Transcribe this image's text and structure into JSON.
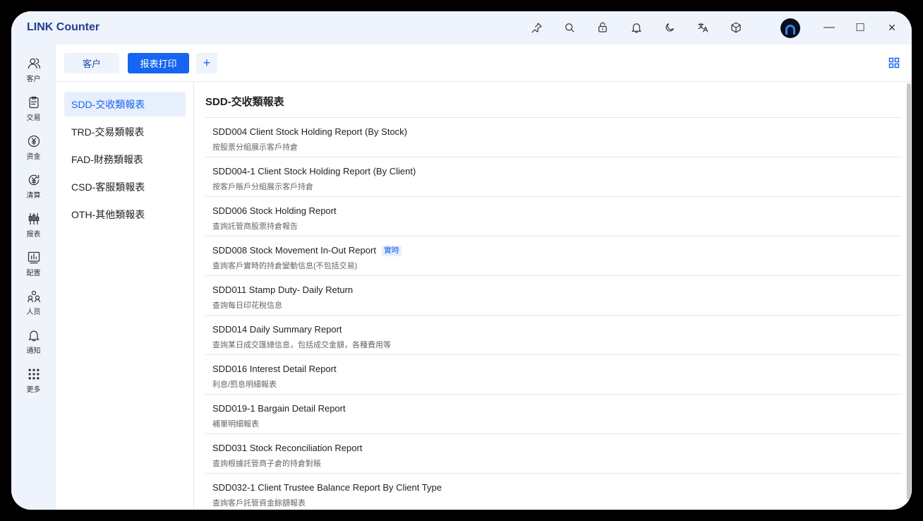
{
  "app": {
    "title": "LINK Counter"
  },
  "titlebar_icons": [
    "pin-icon",
    "search-icon",
    "lock-icon",
    "bell-icon",
    "moon-icon",
    "translate-icon",
    "cube-icon"
  ],
  "window_controls": {
    "minimize": "—",
    "maximize": "☐",
    "close": "✕"
  },
  "sidebar": {
    "items": [
      {
        "label": "客户",
        "icon": "users-icon"
      },
      {
        "label": "交易",
        "icon": "clipboard-icon"
      },
      {
        "label": "资金",
        "icon": "yen-icon"
      },
      {
        "label": "清算",
        "icon": "yen-cycle-icon"
      },
      {
        "label": "报表",
        "icon": "candlestick-icon"
      },
      {
        "label": "配置",
        "icon": "chart-config-icon"
      },
      {
        "label": "人员",
        "icon": "people-group-icon"
      },
      {
        "label": "通知",
        "icon": "bell-icon"
      },
      {
        "label": "更多",
        "icon": "dots-grid-icon"
      }
    ]
  },
  "tabs": {
    "customer": "客户",
    "report_print": "报表打印",
    "add": "+"
  },
  "categories": [
    {
      "label": "SDD-交收類報表",
      "active": true
    },
    {
      "label": "TRD-交易類報表",
      "active": false
    },
    {
      "label": "FAD-財務類報表",
      "active": false
    },
    {
      "label": "CSD-客服類報表",
      "active": false
    },
    {
      "label": "OTH-其他類報表",
      "active": false
    }
  ],
  "section": {
    "title": "SDD-交收類報表"
  },
  "reports": [
    {
      "name": "SDD004 Client Stock Holding Report (By Stock)",
      "desc": "按股票分組展示客戶持倉",
      "badge": ""
    },
    {
      "name": "SDD004-1 Client Stock Holding Report (By Client)",
      "desc": "按客戶賬戶分組展示客戶持倉",
      "badge": ""
    },
    {
      "name": "SDD006 Stock Holding Report",
      "desc": "查詢託管商股票持倉報告",
      "badge": ""
    },
    {
      "name": "SDD008 Stock Movement In-Out Report",
      "desc": "查詢客戶實時的持倉變動信息(不包括交易)",
      "badge": "實時"
    },
    {
      "name": "SDD011 Stamp Duty- Daily Return",
      "desc": "查詢每日印花稅信息",
      "badge": ""
    },
    {
      "name": "SDD014 Daily Summary Report",
      "desc": "查詢某日成交匯總信息，包括成交金額，各種費用等",
      "badge": ""
    },
    {
      "name": "SDD016 Interest Detail Report",
      "desc": "利息/罰息明細報表",
      "badge": ""
    },
    {
      "name": "SDD019-1 Bargain Detail Report",
      "desc": "補單明細報表",
      "badge": ""
    },
    {
      "name": "SDD031 Stock Reconciliation Report",
      "desc": "查詢根據託管商子倉的持倉對賬",
      "badge": ""
    },
    {
      "name": "SDD032-1 Client Trustee Balance Report By Client Type",
      "desc": "查詢客戶託管資金餘額報表",
      "badge": ""
    }
  ]
}
